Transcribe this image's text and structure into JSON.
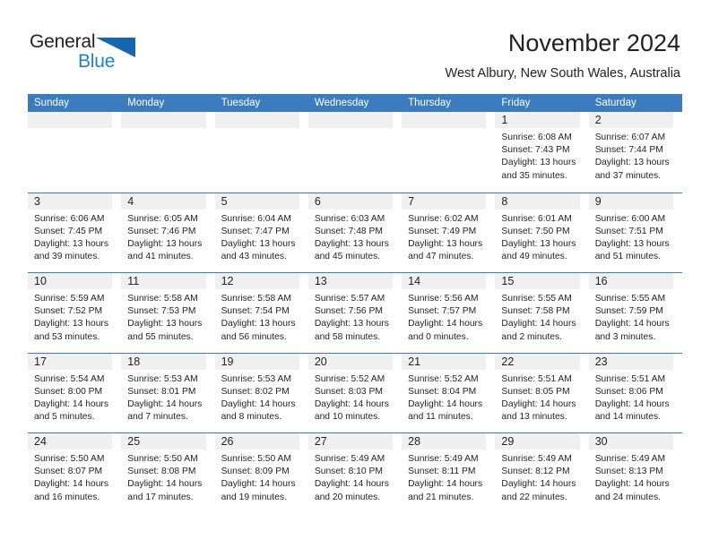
{
  "brand": {
    "name_top": "General",
    "name_bottom": "Blue",
    "triangle_icon": "triangle-icon",
    "color_dark": "#231f20",
    "color_blue": "#1f7fd0"
  },
  "header": {
    "title": "November 2024",
    "subtitle": "West Albury, New South Wales, Australia"
  },
  "theme": {
    "header_blue": "#3a7cbe",
    "row_divider": "#3a7cbe",
    "day_strip_gray": "#f0f0f0",
    "text": "#231f20"
  },
  "calendar": {
    "weekday_headers": [
      "Sunday",
      "Monday",
      "Tuesday",
      "Wednesday",
      "Thursday",
      "Friday",
      "Saturday"
    ],
    "labels": {
      "sunrise": "Sunrise:",
      "sunset": "Sunset:",
      "daylight": "Daylight:"
    },
    "weeks": [
      [
        {
          "day": "",
          "sunrise": "",
          "sunset": "",
          "daylight_l1": "",
          "daylight_l2": ""
        },
        {
          "day": "",
          "sunrise": "",
          "sunset": "",
          "daylight_l1": "",
          "daylight_l2": ""
        },
        {
          "day": "",
          "sunrise": "",
          "sunset": "",
          "daylight_l1": "",
          "daylight_l2": ""
        },
        {
          "day": "",
          "sunrise": "",
          "sunset": "",
          "daylight_l1": "",
          "daylight_l2": ""
        },
        {
          "day": "",
          "sunrise": "",
          "sunset": "",
          "daylight_l1": "",
          "daylight_l2": ""
        },
        {
          "day": "1",
          "sunrise": "Sunrise: 6:08 AM",
          "sunset": "Sunset: 7:43 PM",
          "daylight_l1": "Daylight: 13 hours",
          "daylight_l2": "and 35 minutes."
        },
        {
          "day": "2",
          "sunrise": "Sunrise: 6:07 AM",
          "sunset": "Sunset: 7:44 PM",
          "daylight_l1": "Daylight: 13 hours",
          "daylight_l2": "and 37 minutes."
        }
      ],
      [
        {
          "day": "3",
          "sunrise": "Sunrise: 6:06 AM",
          "sunset": "Sunset: 7:45 PM",
          "daylight_l1": "Daylight: 13 hours",
          "daylight_l2": "and 39 minutes."
        },
        {
          "day": "4",
          "sunrise": "Sunrise: 6:05 AM",
          "sunset": "Sunset: 7:46 PM",
          "daylight_l1": "Daylight: 13 hours",
          "daylight_l2": "and 41 minutes."
        },
        {
          "day": "5",
          "sunrise": "Sunrise: 6:04 AM",
          "sunset": "Sunset: 7:47 PM",
          "daylight_l1": "Daylight: 13 hours",
          "daylight_l2": "and 43 minutes."
        },
        {
          "day": "6",
          "sunrise": "Sunrise: 6:03 AM",
          "sunset": "Sunset: 7:48 PM",
          "daylight_l1": "Daylight: 13 hours",
          "daylight_l2": "and 45 minutes."
        },
        {
          "day": "7",
          "sunrise": "Sunrise: 6:02 AM",
          "sunset": "Sunset: 7:49 PM",
          "daylight_l1": "Daylight: 13 hours",
          "daylight_l2": "and 47 minutes."
        },
        {
          "day": "8",
          "sunrise": "Sunrise: 6:01 AM",
          "sunset": "Sunset: 7:50 PM",
          "daylight_l1": "Daylight: 13 hours",
          "daylight_l2": "and 49 minutes."
        },
        {
          "day": "9",
          "sunrise": "Sunrise: 6:00 AM",
          "sunset": "Sunset: 7:51 PM",
          "daylight_l1": "Daylight: 13 hours",
          "daylight_l2": "and 51 minutes."
        }
      ],
      [
        {
          "day": "10",
          "sunrise": "Sunrise: 5:59 AM",
          "sunset": "Sunset: 7:52 PM",
          "daylight_l1": "Daylight: 13 hours",
          "daylight_l2": "and 53 minutes."
        },
        {
          "day": "11",
          "sunrise": "Sunrise: 5:58 AM",
          "sunset": "Sunset: 7:53 PM",
          "daylight_l1": "Daylight: 13 hours",
          "daylight_l2": "and 55 minutes."
        },
        {
          "day": "12",
          "sunrise": "Sunrise: 5:58 AM",
          "sunset": "Sunset: 7:54 PM",
          "daylight_l1": "Daylight: 13 hours",
          "daylight_l2": "and 56 minutes."
        },
        {
          "day": "13",
          "sunrise": "Sunrise: 5:57 AM",
          "sunset": "Sunset: 7:56 PM",
          "daylight_l1": "Daylight: 13 hours",
          "daylight_l2": "and 58 minutes."
        },
        {
          "day": "14",
          "sunrise": "Sunrise: 5:56 AM",
          "sunset": "Sunset: 7:57 PM",
          "daylight_l1": "Daylight: 14 hours",
          "daylight_l2": "and 0 minutes."
        },
        {
          "day": "15",
          "sunrise": "Sunrise: 5:55 AM",
          "sunset": "Sunset: 7:58 PM",
          "daylight_l1": "Daylight: 14 hours",
          "daylight_l2": "and 2 minutes."
        },
        {
          "day": "16",
          "sunrise": "Sunrise: 5:55 AM",
          "sunset": "Sunset: 7:59 PM",
          "daylight_l1": "Daylight: 14 hours",
          "daylight_l2": "and 3 minutes."
        }
      ],
      [
        {
          "day": "17",
          "sunrise": "Sunrise: 5:54 AM",
          "sunset": "Sunset: 8:00 PM",
          "daylight_l1": "Daylight: 14 hours",
          "daylight_l2": "and 5 minutes."
        },
        {
          "day": "18",
          "sunrise": "Sunrise: 5:53 AM",
          "sunset": "Sunset: 8:01 PM",
          "daylight_l1": "Daylight: 14 hours",
          "daylight_l2": "and 7 minutes."
        },
        {
          "day": "19",
          "sunrise": "Sunrise: 5:53 AM",
          "sunset": "Sunset: 8:02 PM",
          "daylight_l1": "Daylight: 14 hours",
          "daylight_l2": "and 8 minutes."
        },
        {
          "day": "20",
          "sunrise": "Sunrise: 5:52 AM",
          "sunset": "Sunset: 8:03 PM",
          "daylight_l1": "Daylight: 14 hours",
          "daylight_l2": "and 10 minutes."
        },
        {
          "day": "21",
          "sunrise": "Sunrise: 5:52 AM",
          "sunset": "Sunset: 8:04 PM",
          "daylight_l1": "Daylight: 14 hours",
          "daylight_l2": "and 11 minutes."
        },
        {
          "day": "22",
          "sunrise": "Sunrise: 5:51 AM",
          "sunset": "Sunset: 8:05 PM",
          "daylight_l1": "Daylight: 14 hours",
          "daylight_l2": "and 13 minutes."
        },
        {
          "day": "23",
          "sunrise": "Sunrise: 5:51 AM",
          "sunset": "Sunset: 8:06 PM",
          "daylight_l1": "Daylight: 14 hours",
          "daylight_l2": "and 14 minutes."
        }
      ],
      [
        {
          "day": "24",
          "sunrise": "Sunrise: 5:50 AM",
          "sunset": "Sunset: 8:07 PM",
          "daylight_l1": "Daylight: 14 hours",
          "daylight_l2": "and 16 minutes."
        },
        {
          "day": "25",
          "sunrise": "Sunrise: 5:50 AM",
          "sunset": "Sunset: 8:08 PM",
          "daylight_l1": "Daylight: 14 hours",
          "daylight_l2": "and 17 minutes."
        },
        {
          "day": "26",
          "sunrise": "Sunrise: 5:50 AM",
          "sunset": "Sunset: 8:09 PM",
          "daylight_l1": "Daylight: 14 hours",
          "daylight_l2": "and 19 minutes."
        },
        {
          "day": "27",
          "sunrise": "Sunrise: 5:49 AM",
          "sunset": "Sunset: 8:10 PM",
          "daylight_l1": "Daylight: 14 hours",
          "daylight_l2": "and 20 minutes."
        },
        {
          "day": "28",
          "sunrise": "Sunrise: 5:49 AM",
          "sunset": "Sunset: 8:11 PM",
          "daylight_l1": "Daylight: 14 hours",
          "daylight_l2": "and 21 minutes."
        },
        {
          "day": "29",
          "sunrise": "Sunrise: 5:49 AM",
          "sunset": "Sunset: 8:12 PM",
          "daylight_l1": "Daylight: 14 hours",
          "daylight_l2": "and 22 minutes."
        },
        {
          "day": "30",
          "sunrise": "Sunrise: 5:49 AM",
          "sunset": "Sunset: 8:13 PM",
          "daylight_l1": "Daylight: 14 hours",
          "daylight_l2": "and 24 minutes."
        }
      ]
    ]
  }
}
